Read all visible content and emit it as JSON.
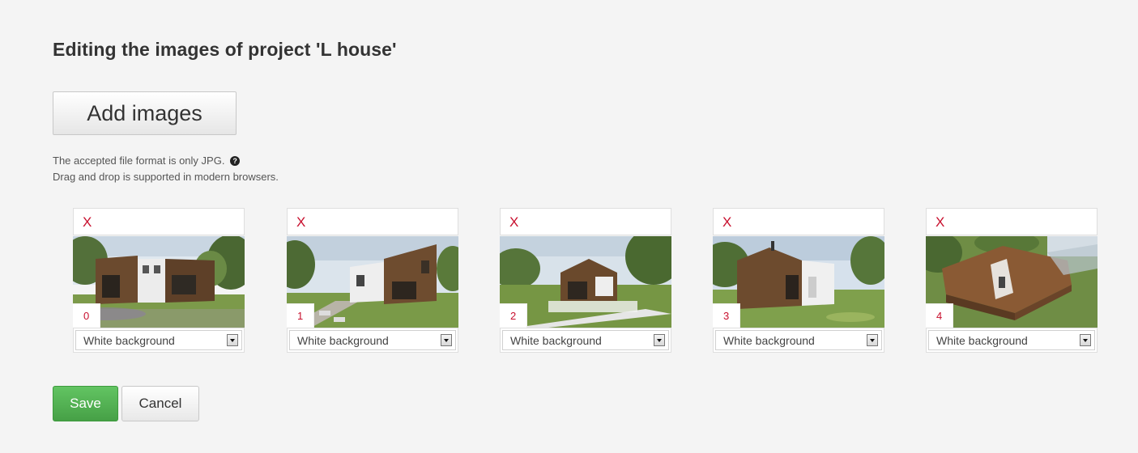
{
  "page": {
    "title": "Editing the images of project 'L house'"
  },
  "upload": {
    "add_label": "Add images",
    "format_note": "The accepted file format is only JPG.",
    "help_icon": "question-circle-icon",
    "help_glyph": "?",
    "drag_note": "Drag and drop is supported in modern browsers."
  },
  "images": [
    {
      "delete_label": "X",
      "index": "0",
      "background": "White background"
    },
    {
      "delete_label": "X",
      "index": "1",
      "background": "White background"
    },
    {
      "delete_label": "X",
      "index": "2",
      "background": "White background"
    },
    {
      "delete_label": "X",
      "index": "3",
      "background": "White background"
    },
    {
      "delete_label": "X",
      "index": "4",
      "background": "White background"
    }
  ],
  "actions": {
    "save_label": "Save",
    "cancel_label": "Cancel"
  },
  "colors": {
    "background": "#f4f4f4",
    "delete_red": "#c8102e",
    "save_green": "#52b052"
  }
}
